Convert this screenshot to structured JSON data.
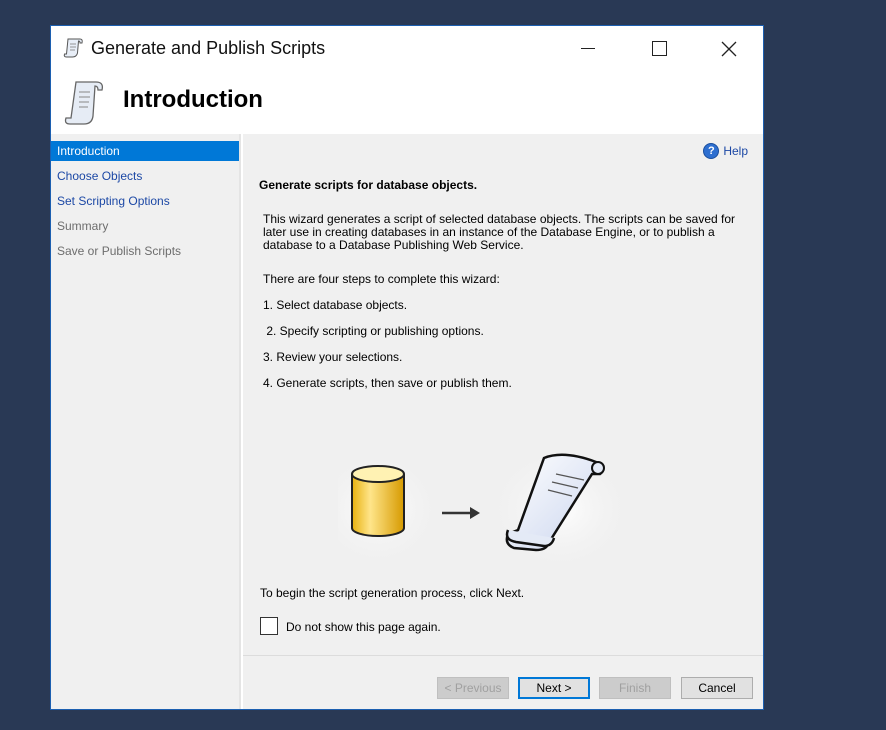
{
  "window": {
    "title": "Generate and Publish Scripts",
    "header_title": "Introduction"
  },
  "sidebar": {
    "items": [
      {
        "label": "Introduction",
        "state": "active"
      },
      {
        "label": "Choose Objects",
        "state": "link"
      },
      {
        "label": "Set Scripting Options",
        "state": "link"
      },
      {
        "label": "Summary",
        "state": "disabled"
      },
      {
        "label": "Save or Publish Scripts",
        "state": "disabled"
      }
    ]
  },
  "content": {
    "help_label": "Help",
    "heading": "Generate scripts for database objects.",
    "description": "This wizard generates a script of selected database objects. The scripts can be saved for later use in creating databases in an instance of the Database Engine, or to publish a database to a Database Publishing Web Service.",
    "steps_intro": "There are four steps to complete this wizard:",
    "steps": [
      "1. Select database objects.",
      " 2. Specify scripting or publishing options.",
      "3. Review your selections.",
      "4. Generate scripts, then save or publish them."
    ],
    "begin_text": "To begin the script generation process, click Next.",
    "checkbox_label": "Do not show this page again."
  },
  "buttons": {
    "previous": "< Previous",
    "next": "Next >",
    "finish": "Finish",
    "cancel": "Cancel"
  },
  "colors": {
    "desktop": "#293955",
    "accent": "#0078d7",
    "link": "#1c48a5"
  }
}
